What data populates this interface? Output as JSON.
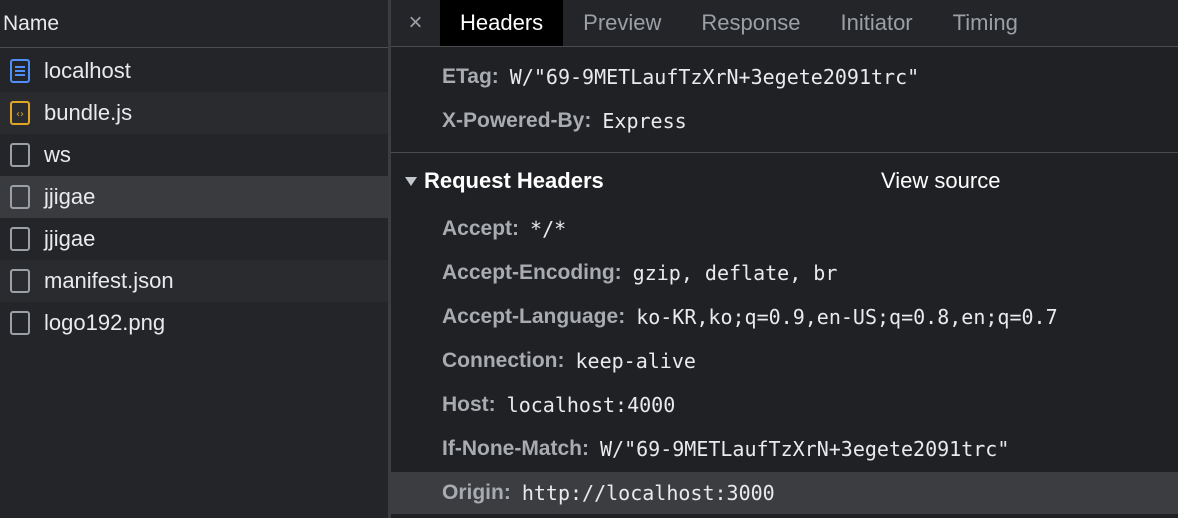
{
  "list": {
    "header": "Name",
    "rows": [
      {
        "label": "localhost",
        "icon": "document-icon"
      },
      {
        "label": "bundle.js",
        "icon": "script-file-icon"
      },
      {
        "label": "ws",
        "icon": "blank-file-icon"
      },
      {
        "label": "jjigae",
        "icon": "blank-file-icon"
      },
      {
        "label": "jjigae",
        "icon": "blank-file-icon"
      },
      {
        "label": "manifest.json",
        "icon": "blank-file-icon"
      },
      {
        "label": "logo192.png",
        "icon": "blank-file-icon"
      }
    ],
    "selected_index": 3
  },
  "tabs": {
    "close": "×",
    "items": [
      "Headers",
      "Preview",
      "Response",
      "Initiator",
      "Timing"
    ],
    "active": "Headers"
  },
  "response_headers": [
    {
      "key": "ETag:",
      "value": "W/\"69-9METLaufTzXrN+3egete2091trc\""
    },
    {
      "key": "X-Powered-By:",
      "value": "Express"
    }
  ],
  "request_section": {
    "title": "Request Headers",
    "view_source": "View source"
  },
  "request_headers": [
    {
      "key": "Accept:",
      "value": "*/*"
    },
    {
      "key": "Accept-Encoding:",
      "value": "gzip, deflate, br"
    },
    {
      "key": "Accept-Language:",
      "value": "ko-KR,ko;q=0.9,en-US;q=0.8,en;q=0.7"
    },
    {
      "key": "Connection:",
      "value": "keep-alive"
    },
    {
      "key": "Host:",
      "value": "localhost:4000"
    },
    {
      "key": "If-None-Match:",
      "value": "W/\"69-9METLaufTzXrN+3egete2091trc\""
    },
    {
      "key": "Origin:",
      "value": "http://localhost:3000"
    }
  ],
  "colors": {
    "doc_icon": "#4f8ff7",
    "script_icon": "#e0a526",
    "blank_icon": "#9aa0a6"
  }
}
